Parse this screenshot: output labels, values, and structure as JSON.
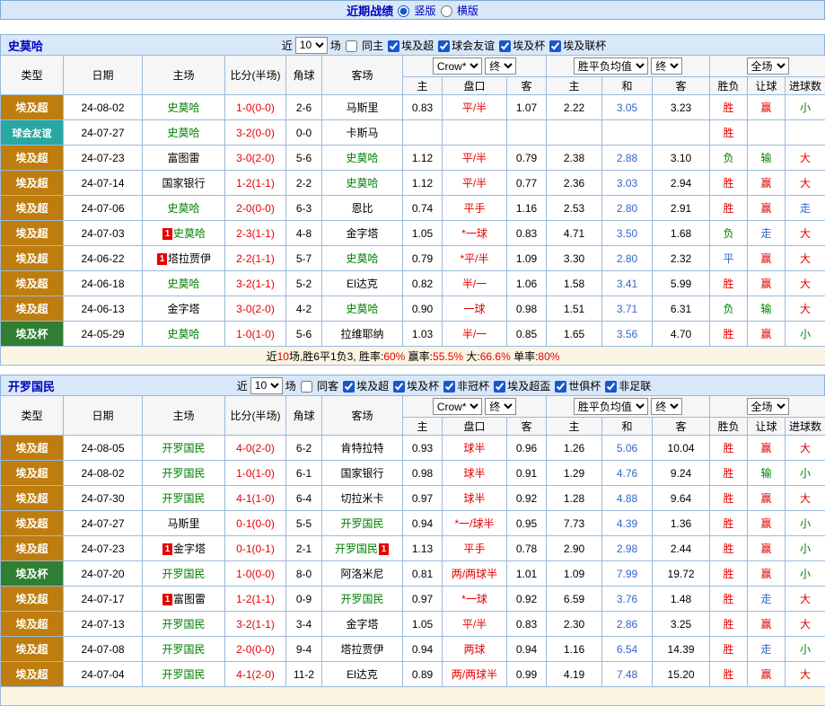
{
  "topbar": {
    "title": "近期战绩",
    "layout_options": [
      {
        "label": "竖版",
        "selected": true
      },
      {
        "label": "横版",
        "selected": false
      }
    ]
  },
  "table_header": {
    "static_cols": [
      "类型",
      "日期",
      "主场",
      "比分(半场)",
      "角球",
      "客场"
    ],
    "sub_cols": [
      "主",
      "盘口",
      "客",
      "主",
      "和",
      "客",
      "胜负",
      "让球",
      "进球数"
    ],
    "odds_company_select": "Crow*",
    "odds_time_select": "终",
    "europe_select": "胜平负均值",
    "europe_time_select": "终",
    "scope_select": "全场"
  },
  "colors": {
    "league_super": "#BE7D0E",
    "league_friendly": "#29A7A3",
    "league_cup": "#2F7E32",
    "accent_blue": "#0000BB",
    "value_red": "#E60000",
    "value_green": "#008000",
    "value_blue": "#3366CC"
  },
  "sections": [
    {
      "team": "史莫哈",
      "near_label": "近",
      "count_select": "10",
      "matches_label": "场",
      "same_filter": {
        "label": "同主",
        "checked": false
      },
      "league_filters": [
        {
          "label": "埃及超",
          "checked": true
        },
        {
          "label": "球会友谊",
          "checked": true
        },
        {
          "label": "埃及杯",
          "checked": true
        },
        {
          "label": "埃及联杯",
          "checked": true
        }
      ],
      "rows": [
        {
          "league": "埃及超",
          "league_cls": "super",
          "date": "24-08-02",
          "home": {
            "name": "史莫哈",
            "green": true
          },
          "score": "1-0(0-0)",
          "corners": "2-6",
          "away": {
            "name": "马斯里"
          },
          "asia_home": "0.83",
          "handicap": "平/半",
          "asia_away": "1.07",
          "eu_home": "2.22",
          "eu_draw": "3.05",
          "eu_away": "3.23",
          "result": {
            "text": "胜",
            "color": "red"
          },
          "handicap_result": {
            "text": "赢",
            "color": "red"
          },
          "goals": {
            "text": "小",
            "color": "green"
          }
        },
        {
          "league": "球会友谊",
          "league_cls": "friendly",
          "date": "24-07-27",
          "home": {
            "name": "史莫哈",
            "green": true
          },
          "score": "3-2(0-0)",
          "corners": "0-0",
          "away": {
            "name": "卡斯马"
          },
          "asia_home": "",
          "handicap": "",
          "asia_away": "",
          "eu_home": "",
          "eu_draw": "",
          "eu_away": "",
          "result": {
            "text": "胜",
            "color": "red"
          },
          "handicap_result": {
            "text": ""
          },
          "goals": {
            "text": ""
          }
        },
        {
          "league": "埃及超",
          "league_cls": "super",
          "date": "24-07-23",
          "home": {
            "name": "富图雷"
          },
          "score": "3-0(2-0)",
          "corners": "5-6",
          "away": {
            "name": "史莫哈",
            "green": true
          },
          "asia_home": "1.12",
          "handicap": "平/半",
          "asia_away": "0.79",
          "eu_home": "2.38",
          "eu_draw": "2.88",
          "eu_away": "3.10",
          "result": {
            "text": "负",
            "color": "green"
          },
          "handicap_result": {
            "text": "输",
            "color": "green"
          },
          "goals": {
            "text": "大",
            "color": "red"
          }
        },
        {
          "league": "埃及超",
          "league_cls": "super",
          "date": "24-07-14",
          "home": {
            "name": "国家银行"
          },
          "score": "1-2(1-1)",
          "corners": "2-2",
          "away": {
            "name": "史莫哈",
            "green": true
          },
          "asia_home": "1.12",
          "handicap": "平/半",
          "asia_away": "0.77",
          "eu_home": "2.36",
          "eu_draw": "3.03",
          "eu_away": "2.94",
          "result": {
            "text": "胜",
            "color": "red"
          },
          "handicap_result": {
            "text": "赢",
            "color": "red"
          },
          "goals": {
            "text": "大",
            "color": "red"
          }
        },
        {
          "league": "埃及超",
          "league_cls": "super",
          "date": "24-07-06",
          "home": {
            "name": "史莫哈",
            "green": true
          },
          "score": "2-0(0-0)",
          "corners": "6-3",
          "away": {
            "name": "恩比"
          },
          "asia_home": "0.74",
          "handicap": "平手",
          "asia_away": "1.16",
          "eu_home": "2.53",
          "eu_draw": "2.80",
          "eu_away": "2.91",
          "result": {
            "text": "胜",
            "color": "red"
          },
          "handicap_result": {
            "text": "赢",
            "color": "red"
          },
          "goals": {
            "text": "走",
            "color": "blue"
          }
        },
        {
          "league": "埃及超",
          "league_cls": "super",
          "date": "24-07-03",
          "home": {
            "name": "史莫哈",
            "green": true,
            "badge_before": "1"
          },
          "score": "2-3(1-1)",
          "corners": "4-8",
          "away": {
            "name": "金字塔"
          },
          "asia_home": "1.05",
          "handicap": "*一球",
          "asia_away": "0.83",
          "eu_home": "4.71",
          "eu_draw": "3.50",
          "eu_away": "1.68",
          "result": {
            "text": "负",
            "color": "green"
          },
          "handicap_result": {
            "text": "走",
            "color": "blue"
          },
          "goals": {
            "text": "大",
            "color": "red"
          }
        },
        {
          "league": "埃及超",
          "league_cls": "super",
          "date": "24-06-22",
          "home": {
            "name": "塔拉贾伊",
            "badge_before": "1"
          },
          "score": "2-2(1-1)",
          "corners": "5-7",
          "away": {
            "name": "史莫哈",
            "green": true
          },
          "asia_home": "0.79",
          "handicap": "*平/半",
          "asia_away": "1.09",
          "eu_home": "3.30",
          "eu_draw": "2.80",
          "eu_away": "2.32",
          "result": {
            "text": "平",
            "color": "blue"
          },
          "handicap_result": {
            "text": "赢",
            "color": "red"
          },
          "goals": {
            "text": "大",
            "color": "red"
          }
        },
        {
          "league": "埃及超",
          "league_cls": "super",
          "date": "24-06-18",
          "home": {
            "name": "史莫哈",
            "green": true
          },
          "score": "3-2(1-1)",
          "corners": "5-2",
          "away": {
            "name": "El达克"
          },
          "asia_home": "0.82",
          "handicap": "半/一",
          "asia_away": "1.06",
          "eu_home": "1.58",
          "eu_draw": "3.41",
          "eu_away": "5.99",
          "result": {
            "text": "胜",
            "color": "red"
          },
          "handicap_result": {
            "text": "赢",
            "color": "red"
          },
          "goals": {
            "text": "大",
            "color": "red"
          }
        },
        {
          "league": "埃及超",
          "league_cls": "super",
          "date": "24-06-13",
          "home": {
            "name": "金字塔"
          },
          "score": "3-0(2-0)",
          "corners": "4-2",
          "away": {
            "name": "史莫哈",
            "green": true
          },
          "asia_home": "0.90",
          "handicap": "一球",
          "asia_away": "0.98",
          "eu_home": "1.51",
          "eu_draw": "3.71",
          "eu_away": "6.31",
          "result": {
            "text": "负",
            "color": "green"
          },
          "handicap_result": {
            "text": "输",
            "color": "green"
          },
          "goals": {
            "text": "大",
            "color": "red"
          }
        },
        {
          "league": "埃及杯",
          "league_cls": "cup",
          "date": "24-05-29",
          "home": {
            "name": "史莫哈",
            "green": true
          },
          "score": "1-0(1-0)",
          "corners": "5-6",
          "away": {
            "name": "拉维耶纳"
          },
          "asia_home": "1.03",
          "handicap": "半/一",
          "asia_away": "0.85",
          "eu_home": "1.65",
          "eu_draw": "3.56",
          "eu_away": "4.70",
          "result": {
            "text": "胜",
            "color": "red"
          },
          "handicap_result": {
            "text": "赢",
            "color": "red"
          },
          "goals": {
            "text": "小",
            "color": "green"
          }
        }
      ],
      "summary": [
        {
          "t": "近"
        },
        {
          "t": "10",
          "c": "red"
        },
        {
          "t": "场,胜6平1负3, 胜率:"
        },
        {
          "t": "60%",
          "c": "red"
        },
        {
          "t": " 赢率:"
        },
        {
          "t": "55.5%",
          "c": "red"
        },
        {
          "t": " 大:"
        },
        {
          "t": "66.6%",
          "c": "red"
        },
        {
          "t": " 单率:"
        },
        {
          "t": "80%",
          "c": "red"
        }
      ]
    },
    {
      "team": "开罗国民",
      "near_label": "近",
      "count_select": "10",
      "matches_label": "场",
      "same_filter": {
        "label": "同客",
        "checked": false
      },
      "league_filters": [
        {
          "label": "埃及超",
          "checked": true
        },
        {
          "label": "埃及杯",
          "checked": true
        },
        {
          "label": "非冠杯",
          "checked": true
        },
        {
          "label": "埃及超盃",
          "checked": true
        },
        {
          "label": "世俱杯",
          "checked": true
        },
        {
          "label": "非足联",
          "checked": true
        }
      ],
      "rows": [
        {
          "league": "埃及超",
          "league_cls": "super",
          "date": "24-08-05",
          "home": {
            "name": "开罗国民",
            "green": true
          },
          "score": "4-0(2-0)",
          "corners": "6-2",
          "away": {
            "name": "肯特拉特"
          },
          "asia_home": "0.93",
          "handicap": "球半",
          "asia_away": "0.96",
          "eu_home": "1.26",
          "eu_draw": "5.06",
          "eu_away": "10.04",
          "result": {
            "text": "胜",
            "color": "red"
          },
          "handicap_result": {
            "text": "赢",
            "color": "red"
          },
          "goals": {
            "text": "大",
            "color": "red"
          }
        },
        {
          "league": "埃及超",
          "league_cls": "super",
          "date": "24-08-02",
          "home": {
            "name": "开罗国民",
            "green": true
          },
          "score": "1-0(1-0)",
          "corners": "6-1",
          "away": {
            "name": "国家银行"
          },
          "asia_home": "0.98",
          "handicap": "球半",
          "asia_away": "0.91",
          "eu_home": "1.29",
          "eu_draw": "4.76",
          "eu_away": "9.24",
          "result": {
            "text": "胜",
            "color": "red"
          },
          "handicap_result": {
            "text": "输",
            "color": "green"
          },
          "goals": {
            "text": "小",
            "color": "green"
          }
        },
        {
          "league": "埃及超",
          "league_cls": "super",
          "date": "24-07-30",
          "home": {
            "name": "开罗国民",
            "green": true
          },
          "score": "4-1(1-0)",
          "corners": "6-4",
          "away": {
            "name": "切拉米卡"
          },
          "asia_home": "0.97",
          "handicap": "球半",
          "asia_away": "0.92",
          "eu_home": "1.28",
          "eu_draw": "4.88",
          "eu_away": "9.64",
          "result": {
            "text": "胜",
            "color": "red"
          },
          "handicap_result": {
            "text": "赢",
            "color": "red"
          },
          "goals": {
            "text": "大",
            "color": "red"
          }
        },
        {
          "league": "埃及超",
          "league_cls": "super",
          "date": "24-07-27",
          "home": {
            "name": "马斯里"
          },
          "score": "0-1(0-0)",
          "corners": "5-5",
          "away": {
            "name": "开罗国民",
            "green": true
          },
          "asia_home": "0.94",
          "handicap": "*一/球半",
          "asia_away": "0.95",
          "eu_home": "7.73",
          "eu_draw": "4.39",
          "eu_away": "1.36",
          "result": {
            "text": "胜",
            "color": "red"
          },
          "handicap_result": {
            "text": "赢",
            "color": "red"
          },
          "goals": {
            "text": "小",
            "color": "green"
          }
        },
        {
          "league": "埃及超",
          "league_cls": "super",
          "date": "24-07-23",
          "home": {
            "name": "金字塔",
            "badge_before": "1"
          },
          "score": "0-1(0-1)",
          "corners": "2-1",
          "away": {
            "name": "开罗国民",
            "green": true,
            "badge_after": "1"
          },
          "asia_home": "1.13",
          "handicap": "平手",
          "asia_away": "0.78",
          "eu_home": "2.90",
          "eu_draw": "2.98",
          "eu_away": "2.44",
          "result": {
            "text": "胜",
            "color": "red"
          },
          "handicap_result": {
            "text": "赢",
            "color": "red"
          },
          "goals": {
            "text": "小",
            "color": "green"
          }
        },
        {
          "league": "埃及杯",
          "league_cls": "cup",
          "date": "24-07-20",
          "home": {
            "name": "开罗国民",
            "green": true
          },
          "score": "1-0(0-0)",
          "corners": "8-0",
          "away": {
            "name": "阿洛米尼"
          },
          "asia_home": "0.81",
          "handicap": "两/两球半",
          "asia_away": "1.01",
          "eu_home": "1.09",
          "eu_draw": "7.99",
          "eu_away": "19.72",
          "result": {
            "text": "胜",
            "color": "red"
          },
          "handicap_result": {
            "text": "赢",
            "color": "red"
          },
          "goals": {
            "text": "小",
            "color": "green"
          }
        },
        {
          "league": "埃及超",
          "league_cls": "super",
          "date": "24-07-17",
          "home": {
            "name": "富图雷",
            "badge_before": "1"
          },
          "score": "1-2(1-1)",
          "corners": "0-9",
          "away": {
            "name": "开罗国民",
            "green": true
          },
          "asia_home": "0.97",
          "handicap": "*一球",
          "asia_away": "0.92",
          "eu_home": "6.59",
          "eu_draw": "3.76",
          "eu_away": "1.48",
          "result": {
            "text": "胜",
            "color": "red"
          },
          "handicap_result": {
            "text": "走",
            "color": "blue"
          },
          "goals": {
            "text": "大",
            "color": "red"
          }
        },
        {
          "league": "埃及超",
          "league_cls": "super",
          "date": "24-07-13",
          "home": {
            "name": "开罗国民",
            "green": true
          },
          "score": "3-2(1-1)",
          "corners": "3-4",
          "away": {
            "name": "金字塔"
          },
          "asia_home": "1.05",
          "handicap": "平/半",
          "asia_away": "0.83",
          "eu_home": "2.30",
          "eu_draw": "2.86",
          "eu_away": "3.25",
          "result": {
            "text": "胜",
            "color": "red"
          },
          "handicap_result": {
            "text": "赢",
            "color": "red"
          },
          "goals": {
            "text": "大",
            "color": "red"
          }
        },
        {
          "league": "埃及超",
          "league_cls": "super",
          "date": "24-07-08",
          "home": {
            "name": "开罗国民",
            "green": true
          },
          "score": "2-0(0-0)",
          "corners": "9-4",
          "away": {
            "name": "塔拉贾伊"
          },
          "asia_home": "0.94",
          "handicap": "两球",
          "asia_away": "0.94",
          "eu_home": "1.16",
          "eu_draw": "6.54",
          "eu_away": "14.39",
          "result": {
            "text": "胜",
            "color": "red"
          },
          "handicap_result": {
            "text": "走",
            "color": "blue"
          },
          "goals": {
            "text": "小",
            "color": "green"
          }
        },
        {
          "league": "埃及超",
          "league_cls": "super",
          "date": "24-07-04",
          "home": {
            "name": "开罗国民",
            "green": true
          },
          "score": "4-1(2-0)",
          "corners": "11-2",
          "away": {
            "name": "El达克"
          },
          "asia_home": "0.89",
          "handicap": "两/两球半",
          "asia_away": "0.99",
          "eu_home": "4.19",
          "eu_draw": "7.48",
          "eu_away": "15.20",
          "result": {
            "text": "胜",
            "color": "red"
          },
          "handicap_result": {
            "text": "赢",
            "color": "red"
          },
          "goals": {
            "text": "大",
            "color": "red"
          }
        }
      ],
      "summary": []
    }
  ]
}
